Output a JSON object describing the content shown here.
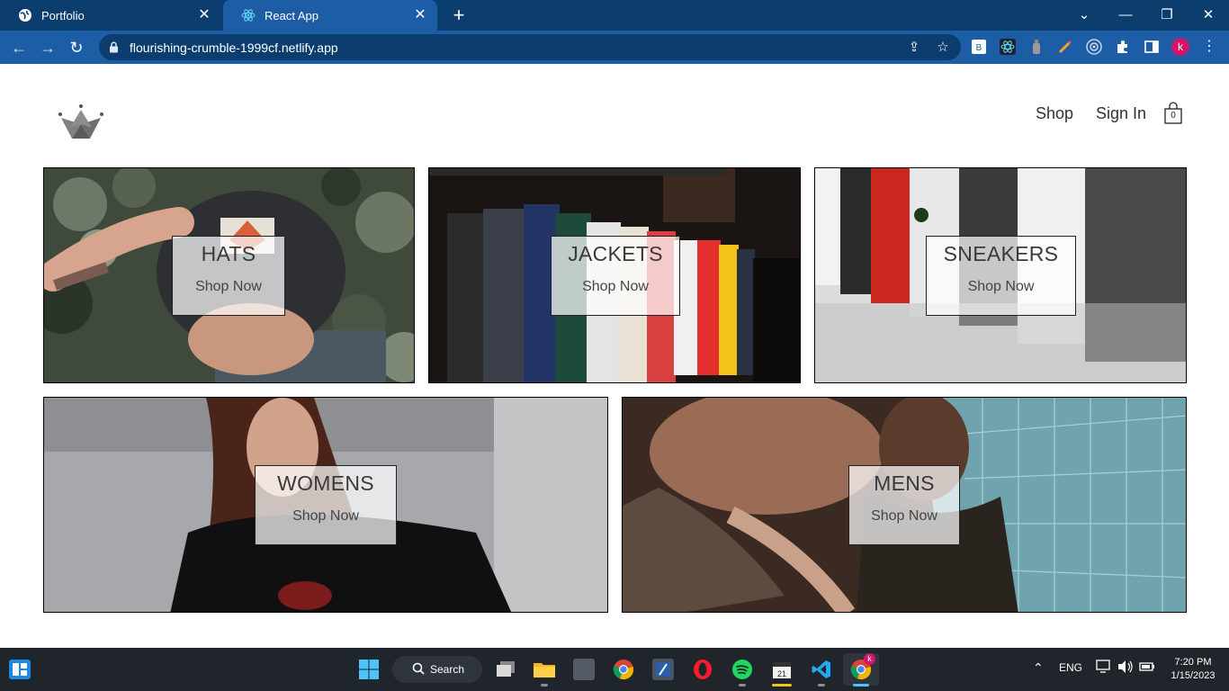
{
  "browser": {
    "tabs": [
      {
        "title": "Portfolio"
      },
      {
        "title": "React App"
      }
    ],
    "url": "flourishing-crumble-1999cf.netlify.app",
    "profile_initial": "k"
  },
  "header": {
    "nav": [
      {
        "label": "Shop"
      },
      {
        "label": "Sign In"
      }
    ],
    "cart_count": "0"
  },
  "categories": [
    {
      "title": "HATS",
      "cta": "Shop Now"
    },
    {
      "title": "JACKETS",
      "cta": "Shop Now"
    },
    {
      "title": "SNEAKERS",
      "cta": "Shop Now"
    },
    {
      "title": "WOMENS",
      "cta": "Shop Now"
    },
    {
      "title": "MENS",
      "cta": "Shop Now"
    }
  ],
  "taskbar": {
    "search_label": "Search",
    "language": "ENG",
    "time": "7:20 PM",
    "date": "1/15/2023"
  },
  "colors": {
    "tabbar": "#0b3d6e",
    "active_tab": "#1d5da6",
    "taskbar": "#20252b"
  }
}
